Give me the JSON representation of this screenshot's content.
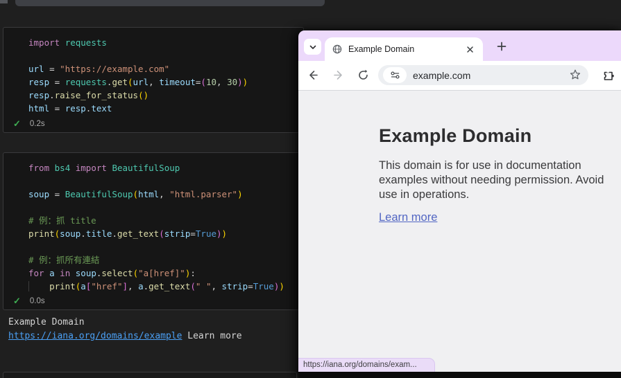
{
  "notebook": {
    "cells": [
      {
        "exec_icon": "check-icon",
        "exec_check": "✓",
        "exec_time": "0.2s",
        "lines": [
          [
            [
              "kw",
              "import"
            ],
            [
              "pl",
              " "
            ],
            [
              "cls",
              "requests"
            ]
          ],
          [],
          [
            [
              "var",
              "url"
            ],
            [
              "pl",
              " = "
            ],
            [
              "str",
              "\"https://example.com\""
            ]
          ],
          [
            [
              "var",
              "resp"
            ],
            [
              "pl",
              " = "
            ],
            [
              "cls",
              "requests"
            ],
            [
              "pl",
              "."
            ],
            [
              "fn",
              "get"
            ],
            [
              "b1",
              "("
            ],
            [
              "var",
              "url"
            ],
            [
              "pl",
              ", "
            ],
            [
              "var",
              "timeout"
            ],
            [
              "pl",
              "="
            ],
            [
              "b2",
              "("
            ],
            [
              "num",
              "10"
            ],
            [
              "pl",
              ", "
            ],
            [
              "num",
              "30"
            ],
            [
              "b2",
              ")"
            ],
            [
              "b1",
              ")"
            ]
          ],
          [
            [
              "var",
              "resp"
            ],
            [
              "pl",
              "."
            ],
            [
              "fn",
              "raise_for_status"
            ],
            [
              "b1",
              "()"
            ]
          ],
          [
            [
              "var",
              "html"
            ],
            [
              "pl",
              " = "
            ],
            [
              "var",
              "resp"
            ],
            [
              "pl",
              "."
            ],
            [
              "var",
              "text"
            ]
          ]
        ]
      },
      {
        "exec_icon": "check-icon",
        "exec_check": "✓",
        "exec_time": "0.0s",
        "lines": [
          [
            [
              "kw",
              "from"
            ],
            [
              "pl",
              " "
            ],
            [
              "cls",
              "bs4"
            ],
            [
              "pl",
              " "
            ],
            [
              "kw",
              "import"
            ],
            [
              "pl",
              " "
            ],
            [
              "cls",
              "BeautifulSoup"
            ]
          ],
          [],
          [
            [
              "var",
              "soup"
            ],
            [
              "pl",
              " = "
            ],
            [
              "cls",
              "BeautifulSoup"
            ],
            [
              "b1",
              "("
            ],
            [
              "var",
              "html"
            ],
            [
              "pl",
              ", "
            ],
            [
              "str",
              "\"html.parser\""
            ],
            [
              "b1",
              ")"
            ]
          ],
          [],
          [
            [
              "cmt",
              "# 例：抓 title"
            ]
          ],
          [
            [
              "fn",
              "print"
            ],
            [
              "b1",
              "("
            ],
            [
              "var",
              "soup"
            ],
            [
              "pl",
              "."
            ],
            [
              "var",
              "title"
            ],
            [
              "pl",
              "."
            ],
            [
              "fn",
              "get_text"
            ],
            [
              "b2",
              "("
            ],
            [
              "var",
              "strip"
            ],
            [
              "pl",
              "="
            ],
            [
              "const",
              "True"
            ],
            [
              "b2",
              ")"
            ],
            [
              "b1",
              ")"
            ]
          ],
          [],
          [
            [
              "cmt",
              "# 例：抓所有連結"
            ]
          ],
          [
            [
              "kw",
              "for"
            ],
            [
              "pl",
              " "
            ],
            [
              "var",
              "a"
            ],
            [
              "pl",
              " "
            ],
            [
              "kw",
              "in"
            ],
            [
              "pl",
              " "
            ],
            [
              "var",
              "soup"
            ],
            [
              "pl",
              "."
            ],
            [
              "fn",
              "select"
            ],
            [
              "b1",
              "("
            ],
            [
              "str",
              "\"a[href]\""
            ],
            [
              "b1",
              ")"
            ],
            [
              "pl",
              ":"
            ]
          ],
          [
            [
              "ind",
              "    "
            ],
            [
              "fn",
              "print"
            ],
            [
              "b1",
              "("
            ],
            [
              "var",
              "a"
            ],
            [
              "b2",
              "["
            ],
            [
              "str",
              "\"href\""
            ],
            [
              "b2",
              "]"
            ],
            [
              "pl",
              ", "
            ],
            [
              "var",
              "a"
            ],
            [
              "pl",
              "."
            ],
            [
              "fn",
              "get_text"
            ],
            [
              "b2",
              "("
            ],
            [
              "str",
              "\" \""
            ],
            [
              "pl",
              ", "
            ],
            [
              "var",
              "strip"
            ],
            [
              "pl",
              "="
            ],
            [
              "const",
              "True"
            ],
            [
              "b2",
              ")"
            ],
            [
              "b1",
              ")"
            ]
          ]
        ]
      }
    ],
    "output": {
      "line1": "Example Domain",
      "link": "https://iana.org/domains/example",
      "after_link": " Learn more"
    }
  },
  "browser": {
    "tab": {
      "title": "Example Domain",
      "site_icon": "globe-icon",
      "close_icon": "x-icon"
    },
    "tabstrip_icons": {
      "dropdown": "chevron-down-icon",
      "new_tab": "plus-icon"
    },
    "toolbar_icons": {
      "back": "arrow-left-icon",
      "forward": "arrow-right-icon",
      "reload": "refresh-icon",
      "site_settings": "tune-sliders-icon",
      "bookmark": "star-icon",
      "extensions": "puzzle-icon"
    },
    "address": "example.com",
    "page": {
      "heading": "Example Domain",
      "body": "This domain is for use in documentation examples without needing permission. Avoid use in operations.",
      "link": "Learn more"
    },
    "status_bubble": "https://iana.org/domains/exam..."
  },
  "colors": {
    "tabstrip_lavender": "#ecd9fb",
    "status_bubble_lavender": "#eadcf8",
    "page_bg": "#f0f0f2",
    "page_link_blue": "#5266c3",
    "output_link_blue": "#4ba0f5",
    "exec_check_green": "#3fae53",
    "editor_bg": "#1f1f1f",
    "cell_bg": "#161616"
  }
}
